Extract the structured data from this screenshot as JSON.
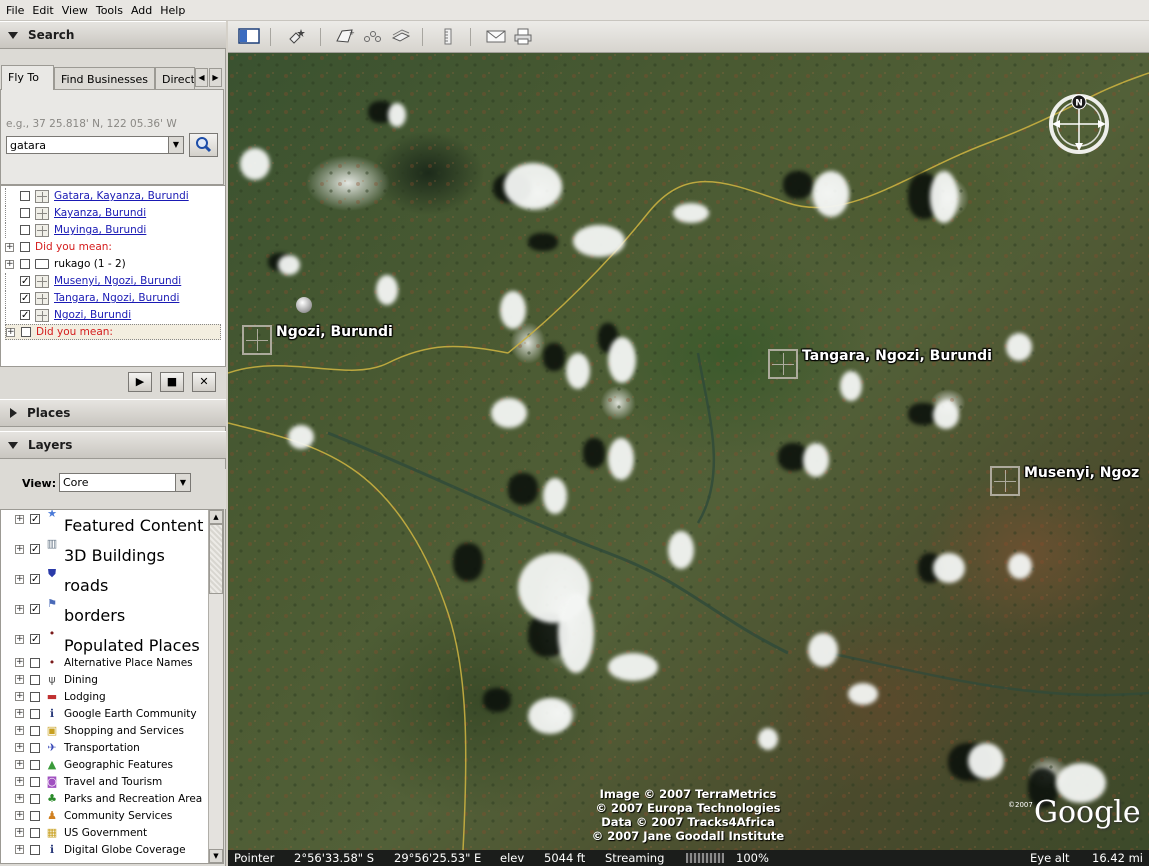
{
  "menu": [
    "File",
    "Edit",
    "View",
    "Tools",
    "Add",
    "Help"
  ],
  "search": {
    "header": "Search",
    "tabs": [
      "Fly To",
      "Find Businesses",
      "Direct"
    ],
    "hint": "e.g., 37 25.818' N, 122 05.36' W",
    "query": "gatara"
  },
  "results": [
    {
      "label": "Gatara, Kayanza, Burundi",
      "kind": "place",
      "checked": false
    },
    {
      "label": "Kayanza, Burundi",
      "kind": "place",
      "checked": false
    },
    {
      "label": "Muyinga, Burundi",
      "kind": "place",
      "checked": false
    },
    {
      "label": "Did you mean:",
      "kind": "suggest",
      "checked": false
    },
    {
      "label": "rukago (1 - 2)",
      "kind": "folder",
      "checked": false
    },
    {
      "label": "Musenyi, Ngozi, Burundi",
      "kind": "place",
      "checked": true
    },
    {
      "label": "Tangara, Ngozi, Burundi",
      "kind": "place",
      "checked": true
    },
    {
      "label": "Ngozi, Burundi",
      "kind": "place",
      "checked": true
    },
    {
      "label": "Did you mean:",
      "kind": "suggest",
      "checked": false
    }
  ],
  "places": {
    "header": "Places"
  },
  "layers": {
    "header": "Layers",
    "view_label": "View:",
    "view_value": "Core",
    "items": [
      {
        "label": "Featured Content",
        "checked": true,
        "big": true,
        "icon": "star-icon"
      },
      {
        "label": "3D Buildings",
        "checked": true,
        "big": true,
        "icon": "building-icon"
      },
      {
        "label": "roads",
        "checked": true,
        "big": true,
        "icon": "road-shield-icon"
      },
      {
        "label": "borders",
        "checked": true,
        "big": true,
        "icon": "flag-icon"
      },
      {
        "label": "Populated Places",
        "checked": true,
        "big": true,
        "icon": "dot-icon"
      },
      {
        "label": "Alternative Place Names",
        "checked": false,
        "big": false,
        "icon": "dot-icon"
      },
      {
        "label": "Dining",
        "checked": false,
        "big": false,
        "icon": "fork-knife-icon"
      },
      {
        "label": "Lodging",
        "checked": false,
        "big": false,
        "icon": "bed-icon"
      },
      {
        "label": "Google Earth Community",
        "checked": false,
        "big": false,
        "icon": "info-icon"
      },
      {
        "label": "Shopping and Services",
        "checked": false,
        "big": false,
        "icon": "shopping-icon"
      },
      {
        "label": "Transportation",
        "checked": false,
        "big": false,
        "icon": "plane-icon"
      },
      {
        "label": "Geographic Features",
        "checked": false,
        "big": false,
        "icon": "mountain-icon"
      },
      {
        "label": "Travel and Tourism",
        "checked": false,
        "big": false,
        "icon": "camera-icon"
      },
      {
        "label": "Parks and Recreation Area",
        "checked": false,
        "big": false,
        "icon": "tree-icon"
      },
      {
        "label": "Community Services",
        "checked": false,
        "big": false,
        "icon": "community-icon"
      },
      {
        "label": "US Government",
        "checked": false,
        "big": false,
        "icon": "government-icon"
      },
      {
        "label": "Digital Globe Coverage",
        "checked": false,
        "big": false,
        "icon": "info-icon"
      }
    ]
  },
  "map": {
    "placemarks": [
      "Ngozi, Burundi",
      "Tangara, Ngozi, Burundi",
      "Musenyi, Ngoz"
    ],
    "compass_north": "N",
    "attribution": [
      "Image © 2007 TerraMetrics",
      "© 2007 Europa Technologies",
      "Data © 2007 Tracks4Africa",
      "© 2007 Jane Goodall Institute"
    ],
    "logo": "Google",
    "logo_year": "©2007"
  },
  "status": {
    "pointer_label": "Pointer",
    "lat": "2°56'33.58\" S",
    "lon": "29°56'25.53\" E",
    "elev_label": "elev",
    "elev": "5044 ft",
    "streaming_label": "Streaming",
    "streaming_pct": "100%",
    "eye_label": "Eye alt",
    "eye_alt": "16.42 mi"
  }
}
